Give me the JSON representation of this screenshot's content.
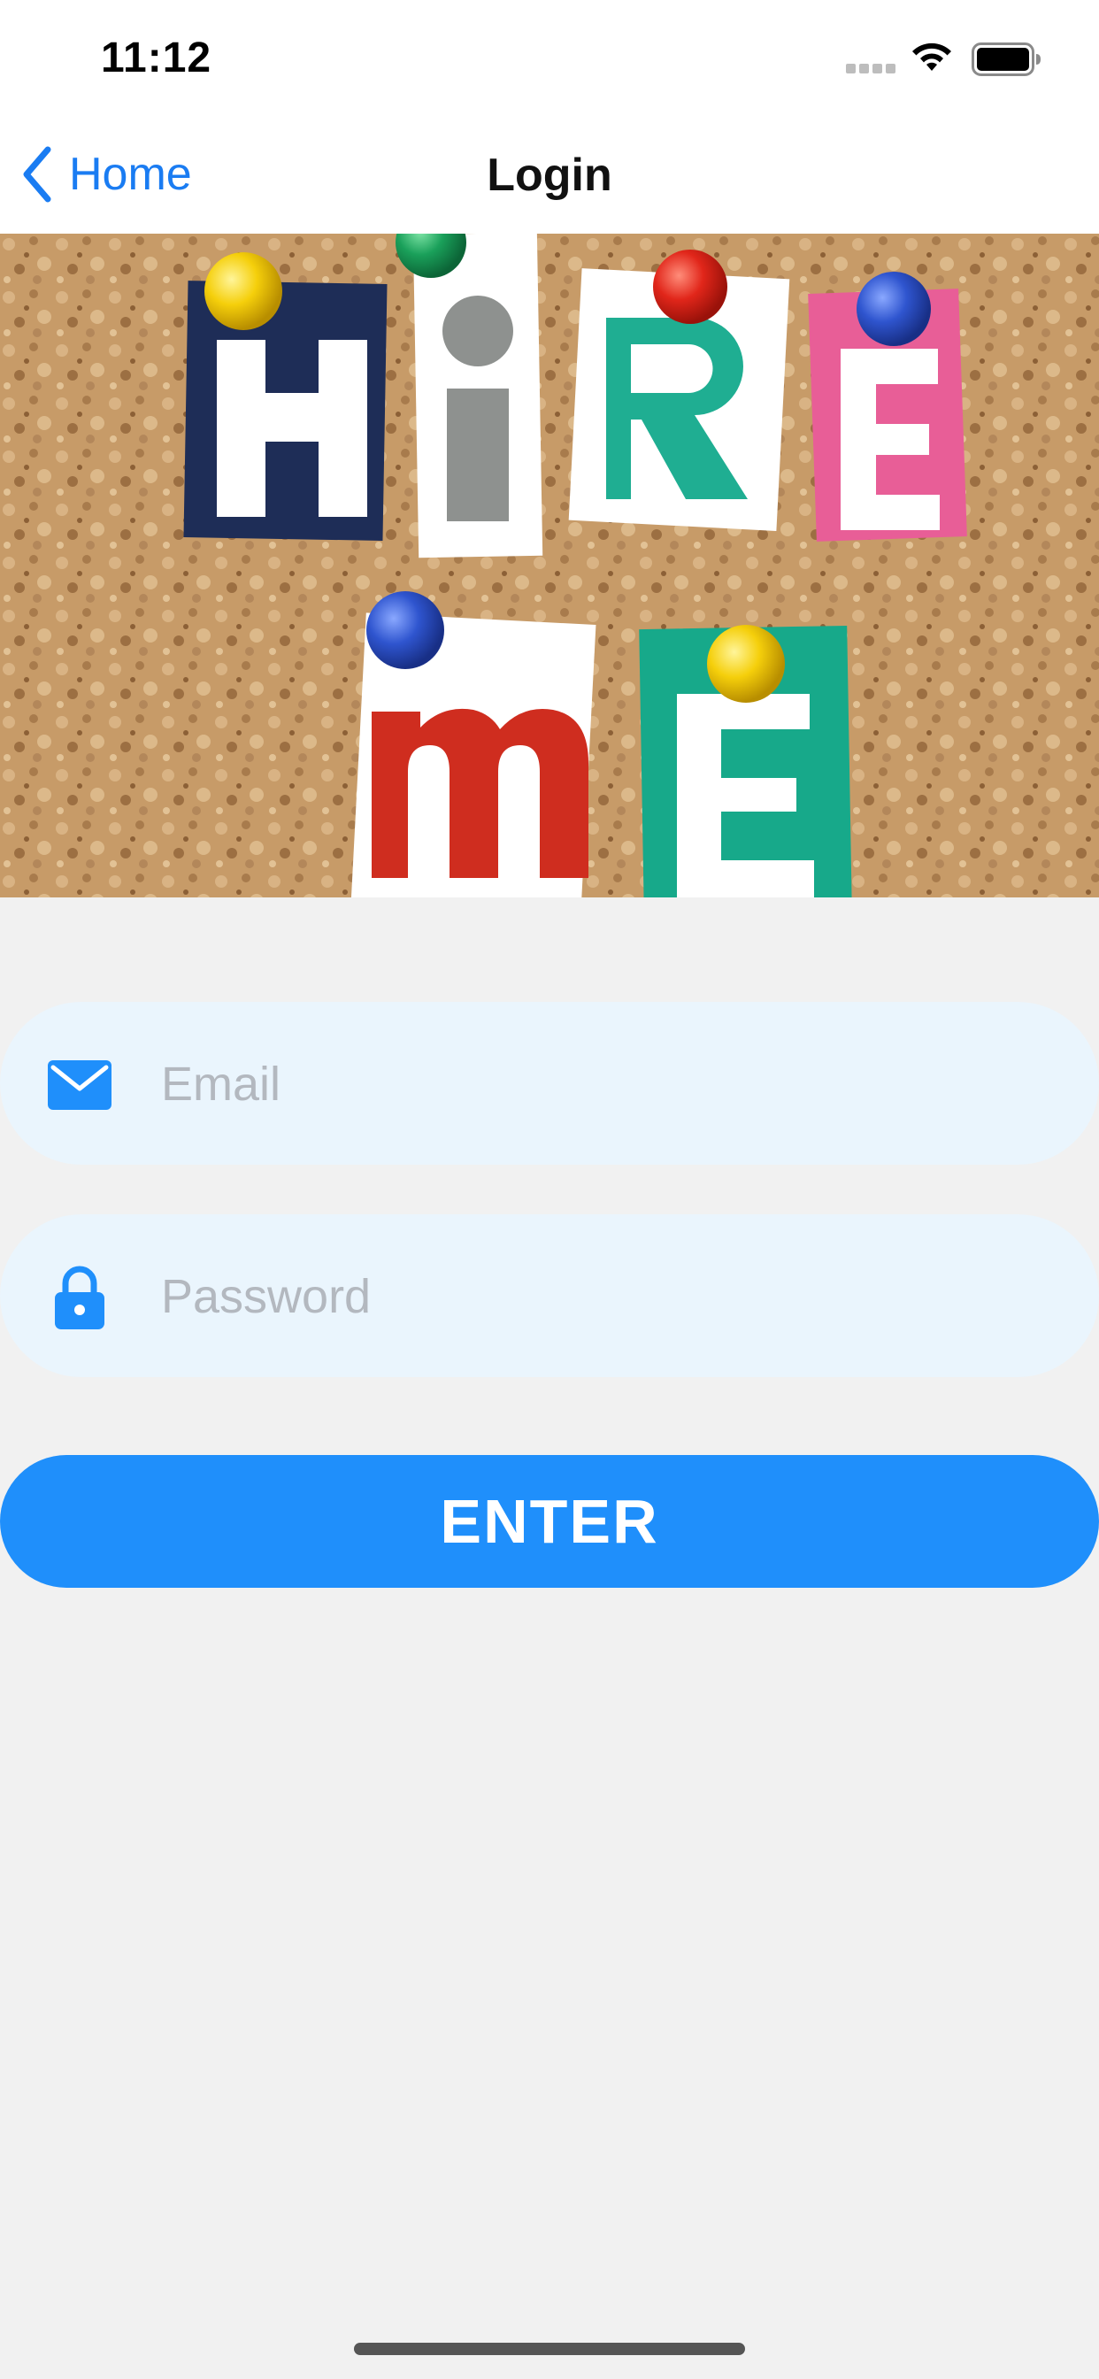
{
  "status_bar": {
    "time": "11:12",
    "icons": [
      "signal-icon",
      "wifi-icon",
      "battery-icon"
    ]
  },
  "nav": {
    "back_label": "Home",
    "title": "Login"
  },
  "hero": {
    "icon": "hire-me-banner-image"
  },
  "form": {
    "email": {
      "placeholder": "Email",
      "value": "",
      "icon": "envelope-icon"
    },
    "password": {
      "placeholder": "Password",
      "value": "",
      "icon": "lock-icon"
    },
    "submit_label": "ENTER"
  },
  "colors": {
    "accent": "#1F8FFB",
    "back_link": "#1A7CF2",
    "field_bg": "#EAF5FD",
    "page_bg": "#F1F1F1"
  }
}
